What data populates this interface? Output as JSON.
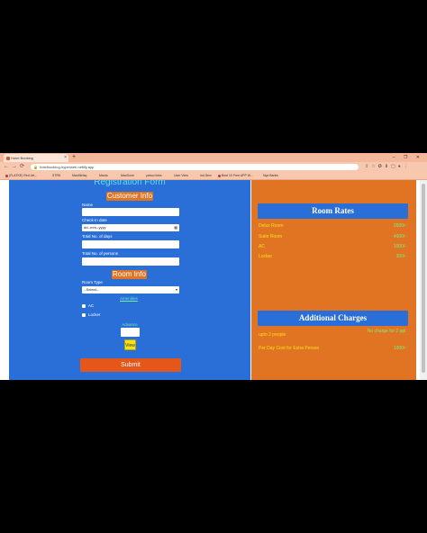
{
  "browser": {
    "tab_title": "Hotel Booking",
    "tab_close": "×",
    "new_tab": "+",
    "window_controls": "–  ❐  ✕",
    "back": "←",
    "forward": "→",
    "reload": "⟳",
    "url": "hotelbooking-hyperweb.netlify.app",
    "bookmarks": [
      "(FLATKE) Red Jet...",
      "STRK",
      "MaxMirfaq",
      "Mania",
      "MaxDone",
      "yahoo links",
      "User View",
      "Ind.Serv",
      "Best 10 Free APP W...",
      "Nya Banks"
    ]
  },
  "form": {
    "title": "Registration Form",
    "customer_info": "Customer Info",
    "name_label": "Name",
    "checkin_label": "Check-in date",
    "checkin_value": "dd--mm--yyyy",
    "days_label": "Total No. of days",
    "persons_label": "Total No. of persons",
    "room_info": "Room Info",
    "room_type_label": "Room Type",
    "room_type_value": "--Select--",
    "amenities_label": "Amenities",
    "amenity_ac": "AC",
    "amenity_locker": "Locker",
    "advance_label": "Advance",
    "view_label": "View",
    "submit_label": "Submit"
  },
  "rates": {
    "title": "Room Rates",
    "items": [
      {
        "name": "Delux Room",
        "price": "2500/-"
      },
      {
        "name": "Suite Room",
        "price": "4000/-"
      },
      {
        "name": "AC",
        "price": "1000/-"
      },
      {
        "name": "Locker",
        "price": "300/-"
      }
    ]
  },
  "charges": {
    "title": "Additional Charges",
    "items": [
      {
        "name": "upto 2 people",
        "price": "No charge for 2 ppl"
      },
      {
        "name": "Per Day Cost for Extra Person",
        "price": "1000/-"
      }
    ]
  },
  "colors": {
    "form_bg": "#2a6ed8",
    "rates_bg": "#e07422",
    "accent_orange": "#e07422",
    "submit": "#e4561a",
    "view_button": "#f5e21a",
    "price_green": "#7cf07c",
    "item_yellow": "#f5e21a"
  }
}
